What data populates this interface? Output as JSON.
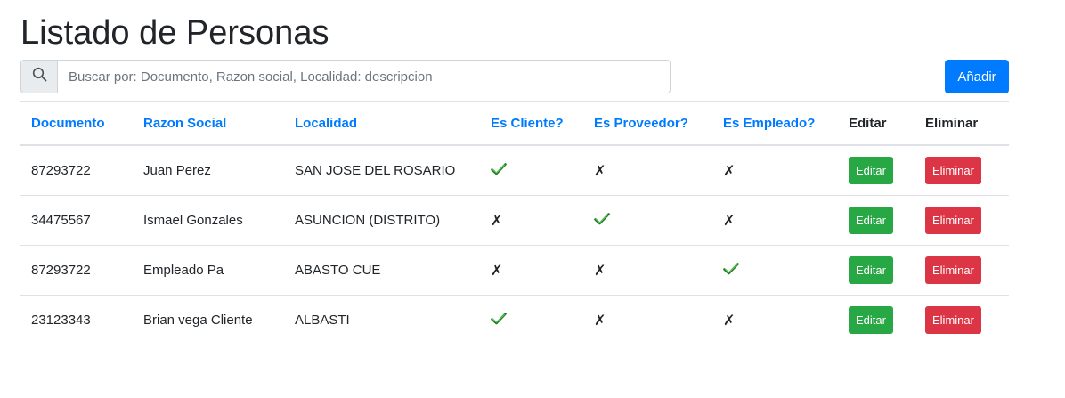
{
  "page": {
    "title": "Listado de Personas"
  },
  "search": {
    "placeholder": "Buscar por: Documento, Razon social, Localidad: descripcion",
    "value": "",
    "icon": "search-icon"
  },
  "add_button": {
    "label": "Añadir",
    "color": "#007bff"
  },
  "colors": {
    "link": "#007bff",
    "edit": "#28a745",
    "delete": "#dc3545",
    "check": "#2e9e2e"
  },
  "table": {
    "headers": {
      "documento": "Documento",
      "razon_social": "Razon Social",
      "localidad": "Localidad",
      "es_cliente": "Es Cliente?",
      "es_proveedor": "Es Proveedor?",
      "es_empleado": "Es Empleado?",
      "editar": "Editar",
      "eliminar": "Eliminar"
    },
    "rows": [
      {
        "documento": "87293722",
        "razon_social": "Juan Perez",
        "localidad": "SAN JOSE DEL ROSARIO",
        "cliente": true,
        "proveedor": false,
        "empleado": false,
        "edit_label": "Editar",
        "delete_label": "Eliminar"
      },
      {
        "documento": "34475567",
        "razon_social": "Ismael Gonzales",
        "localidad": "ASUNCION (DISTRITO)",
        "cliente": false,
        "proveedor": true,
        "empleado": false,
        "edit_label": "Editar",
        "delete_label": "Eliminar"
      },
      {
        "documento": "87293722",
        "razon_social": "Empleado Pa",
        "localidad": "ABASTO CUE",
        "cliente": false,
        "proveedor": false,
        "empleado": true,
        "edit_label": "Editar",
        "delete_label": "Eliminar"
      },
      {
        "documento": "23123343",
        "razon_social": "Brian vega Cliente",
        "localidad": "ALBASTI",
        "cliente": true,
        "proveedor": false,
        "empleado": false,
        "edit_label": "Editar",
        "delete_label": "Eliminar"
      }
    ],
    "false_mark": "✗"
  }
}
